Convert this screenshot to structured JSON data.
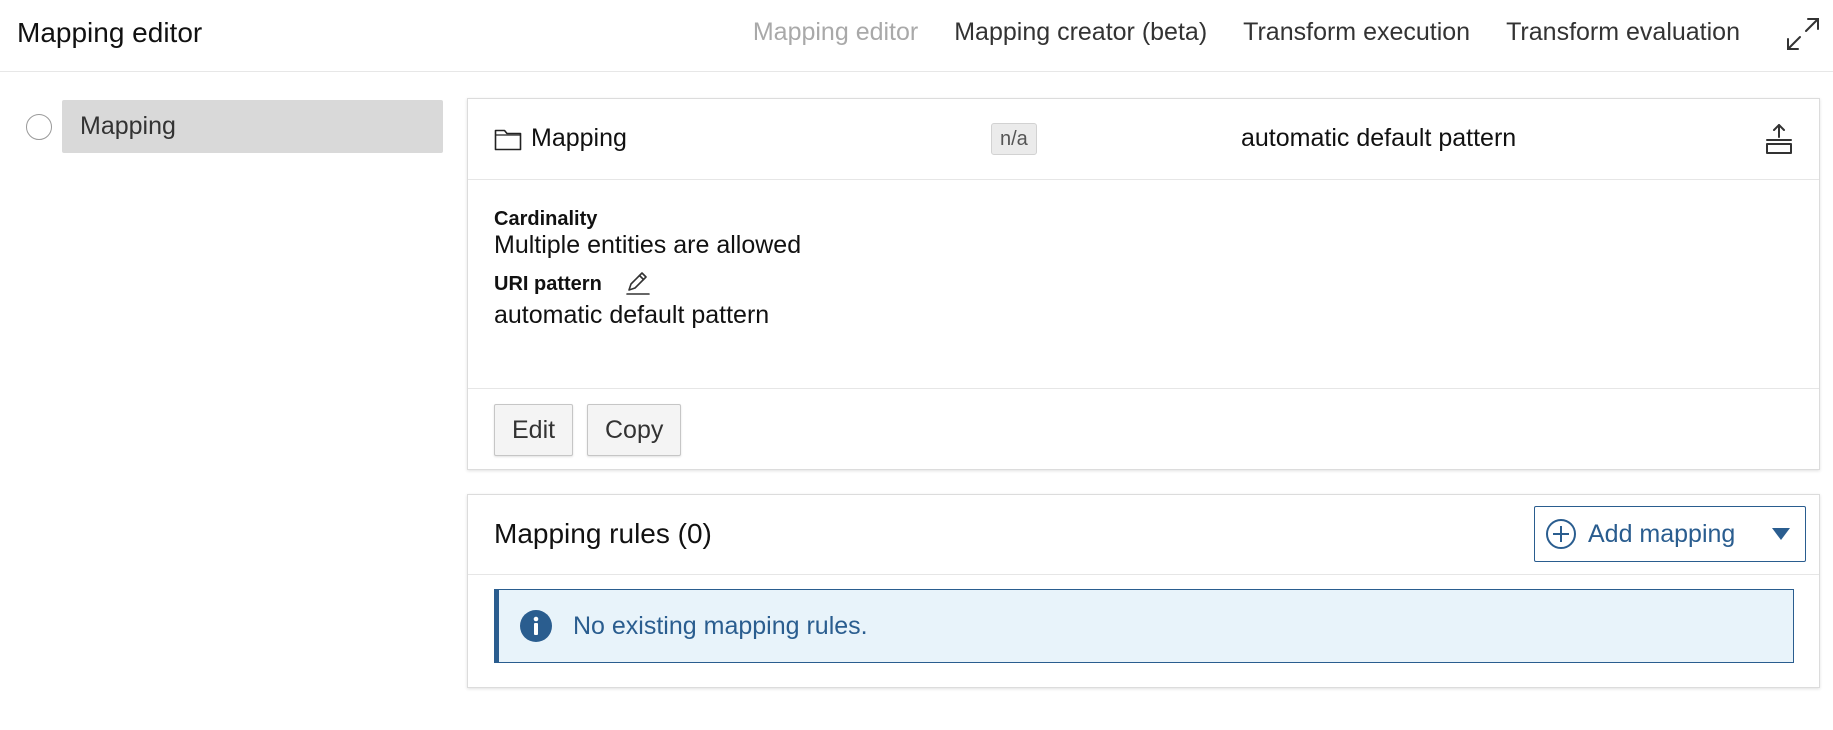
{
  "header": {
    "title": "Mapping editor",
    "tabs": [
      {
        "label": "Mapping editor",
        "active": true
      },
      {
        "label": "Mapping creator (beta)",
        "active": false
      },
      {
        "label": "Transform execution",
        "active": false
      },
      {
        "label": "Transform evaluation",
        "active": false
      }
    ],
    "expand_icon": "expand-arrows-icon"
  },
  "tree": {
    "node_label": "Mapping"
  },
  "mapping_card": {
    "label": "Mapping",
    "type_tag": "n/a",
    "pattern": "automatic default pattern",
    "cardinality_label": "Cardinality",
    "cardinality_value": "Multiple entities are allowed",
    "uri_pattern_label": "URI pattern",
    "uri_pattern_value": "automatic default pattern",
    "edit_label": "Edit",
    "copy_label": "Copy"
  },
  "rules_card": {
    "title": "Mapping rules (0)",
    "add_label": "Add mapping",
    "notice": "No existing mapping rules."
  },
  "colors": {
    "accent": "#2a5d8f",
    "notice_bg": "#e8f3fa",
    "tree_selected_bg": "#d9d9d9",
    "tab_active": "#a9a9a9"
  }
}
